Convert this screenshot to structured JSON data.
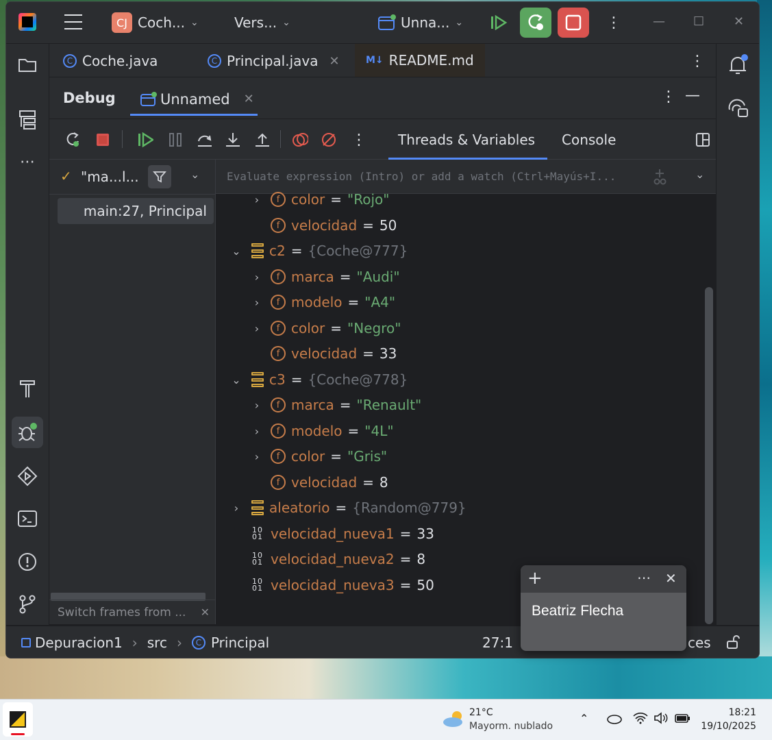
{
  "titlebar": {
    "project_badge": "CJ",
    "project_name": "Coch...",
    "vcs_label": "Vers...",
    "run_config": "Unna...",
    "colors": {
      "resume": "#5fb865",
      "rerun_bg": "#5ba55f",
      "stop_bg": "#d9534f",
      "accent": "#548af7"
    }
  },
  "editor_tabs": [
    {
      "label": "Coche.java",
      "icon": "class-icon"
    },
    {
      "label": "Principal.java",
      "icon": "class-runnable-icon"
    },
    {
      "label": "README.md",
      "icon": "markdown-icon"
    }
  ],
  "markdown_badge": "M↓",
  "debug": {
    "title": "Debug",
    "session_tab": "Unnamed",
    "right_tabs": {
      "threads_variables": "Threads & Variables",
      "console": "Console"
    }
  },
  "frames": {
    "thread_label": "\"ma...l...",
    "selected_frame": "main:27, Principal",
    "hint": "Switch frames from ..."
  },
  "evaluate_placeholder": "Evaluate expression (Intro) or add a watch (Ctrl+Mayús+I...",
  "variables": [
    {
      "indent": 1,
      "arrow": "›",
      "kind": "field",
      "name": "color",
      "value": "\"Rojo\"",
      "vtype": "str"
    },
    {
      "indent": 1,
      "arrow": "",
      "kind": "field",
      "name": "velocidad",
      "value": "50",
      "vtype": "num"
    },
    {
      "indent": 0,
      "arrow": "⌄",
      "kind": "object",
      "name": "c2",
      "value": "{Coche@777}",
      "vtype": "ref"
    },
    {
      "indent": 1,
      "arrow": "›",
      "kind": "field",
      "name": "marca",
      "value": "\"Audi\"",
      "vtype": "str"
    },
    {
      "indent": 1,
      "arrow": "›",
      "kind": "field",
      "name": "modelo",
      "value": "\"A4\"",
      "vtype": "str"
    },
    {
      "indent": 1,
      "arrow": "›",
      "kind": "field",
      "name": "color",
      "value": "\"Negro\"",
      "vtype": "str"
    },
    {
      "indent": 1,
      "arrow": "",
      "kind": "field",
      "name": "velocidad",
      "value": "33",
      "vtype": "num"
    },
    {
      "indent": 0,
      "arrow": "⌄",
      "kind": "object",
      "name": "c3",
      "value": "{Coche@778}",
      "vtype": "ref"
    },
    {
      "indent": 1,
      "arrow": "›",
      "kind": "field",
      "name": "marca",
      "value": "\"Renault\"",
      "vtype": "str"
    },
    {
      "indent": 1,
      "arrow": "›",
      "kind": "field",
      "name": "modelo",
      "value": "\"4L\"",
      "vtype": "str"
    },
    {
      "indent": 1,
      "arrow": "›",
      "kind": "field",
      "name": "color",
      "value": "\"Gris\"",
      "vtype": "str"
    },
    {
      "indent": 1,
      "arrow": "",
      "kind": "field",
      "name": "velocidad",
      "value": "8",
      "vtype": "num"
    },
    {
      "indent": 0,
      "arrow": "›",
      "kind": "object",
      "name": "aleatorio",
      "value": "{Random@779}",
      "vtype": "ref"
    },
    {
      "indent": 0,
      "arrow": "",
      "kind": "primitive",
      "name": "velocidad_nueva1",
      "value": "33",
      "vtype": "num"
    },
    {
      "indent": 0,
      "arrow": "",
      "kind": "primitive",
      "name": "velocidad_nueva2",
      "value": "8",
      "vtype": "num"
    },
    {
      "indent": 0,
      "arrow": "",
      "kind": "primitive",
      "name": "velocidad_nueva3",
      "value": "50",
      "vtype": "num"
    }
  ],
  "field_icon_letter": "f",
  "primitive_icon_text": "10\n01",
  "statusbar": {
    "crumbs": [
      "Depuracion1",
      "src",
      "Principal"
    ],
    "position": "27:1",
    "partial": "ces"
  },
  "sticky_note": {
    "text": "Beatriz Flecha"
  },
  "taskbar": {
    "temperature": "21°C",
    "weather": "Mayorm. nublado",
    "time": "18:21",
    "date": "19/10/2025"
  }
}
